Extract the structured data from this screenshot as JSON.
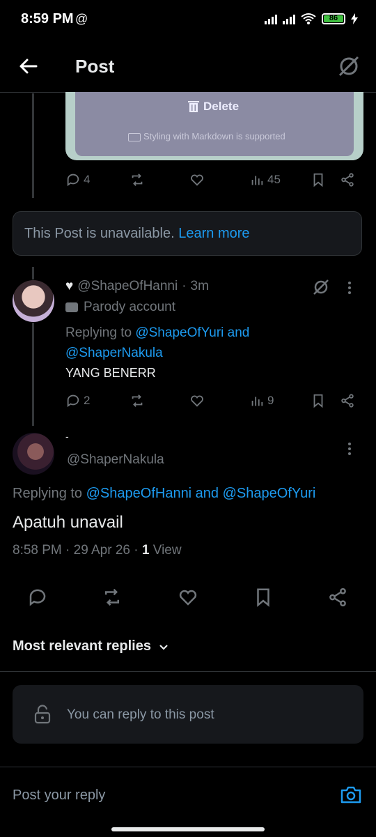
{
  "status_bar": {
    "time": "8:59 PM",
    "battery": "86"
  },
  "header": {
    "title": "Post"
  },
  "card": {
    "delete_label": "Delete",
    "markdown_note": "Styling with Markdown is supported"
  },
  "first_post_actions": {
    "replies": "4",
    "views": "45"
  },
  "unavailable": {
    "text": "This Post is unavailable.",
    "link": "Learn more"
  },
  "reply_hanni": {
    "handle": "@ShapeOfHanni",
    "time": "3m",
    "parody": "Parody account",
    "replying_prefix": "Replying to",
    "replying_user1": "@ShapeOfYuri",
    "replying_and": "and",
    "replying_user2": "@ShaperNakula",
    "text": "YANG BENERR",
    "replies": "2",
    "views": "9"
  },
  "main_post": {
    "display_name": "-",
    "handle": "@ShaperNakula",
    "replying_prefix": "Replying to",
    "replying_users": "@ShapeOfHanni and @ShapeOfYuri",
    "text": "Apatuh unavail",
    "meta": "8:58 PM · 29 Apr 26 · ",
    "view_count": "1",
    "view_label": "View"
  },
  "sort": {
    "label": "Most relevant replies"
  },
  "reply_restriction": {
    "text": "You can reply to this post"
  },
  "composer": {
    "placeholder": "Post your reply"
  },
  "colors": {
    "accent": "#1d9bf0",
    "background": "#000000",
    "muted": "#71767b"
  }
}
